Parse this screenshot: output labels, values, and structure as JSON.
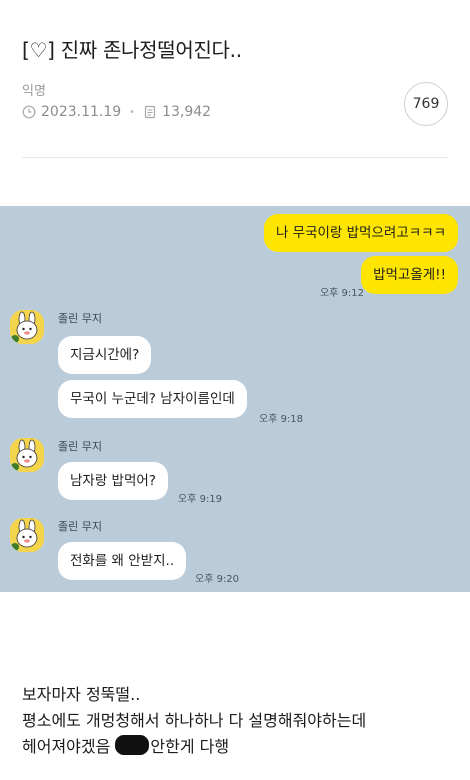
{
  "post": {
    "title": "[♡] 진짜 존나정떨어진다..",
    "author": "익명",
    "date": "2023.11.19",
    "views": "13,942",
    "comment_count": "769"
  },
  "chat": {
    "sender_name": "졸린 무지",
    "messages_me": [
      {
        "text": "나 무국이랑 밥먹으려고ㅋㅋㅋ"
      },
      {
        "text": "밥먹고올게!!",
        "time": "오후 9:12"
      }
    ],
    "messages_them": [
      {
        "text": "지금시간에?"
      },
      {
        "text": "무국이 누군데? 남자이름인데",
        "time": "오후 9:18"
      },
      {
        "text": "남자랑 밥먹어?",
        "time": "오후 9:19"
      },
      {
        "text": "전화를 왜 안받지..",
        "time": "오후 9:20"
      }
    ]
  },
  "body": {
    "line1": "보자마자 정뚝떨..",
    "line2": "평소에도 개멍청해서 하나하나 다 설명해줘야하는데",
    "line3_before": "헤어져야겠음 ",
    "line3_after": "안한게 다행"
  },
  "icons": {
    "clock": "clock-icon",
    "views": "document-icon",
    "avatar": "muzi-character-avatar"
  },
  "colors": {
    "chat_background": "#bacbda",
    "my_bubble": "#fde500",
    "their_bubble": "#ffffff"
  }
}
